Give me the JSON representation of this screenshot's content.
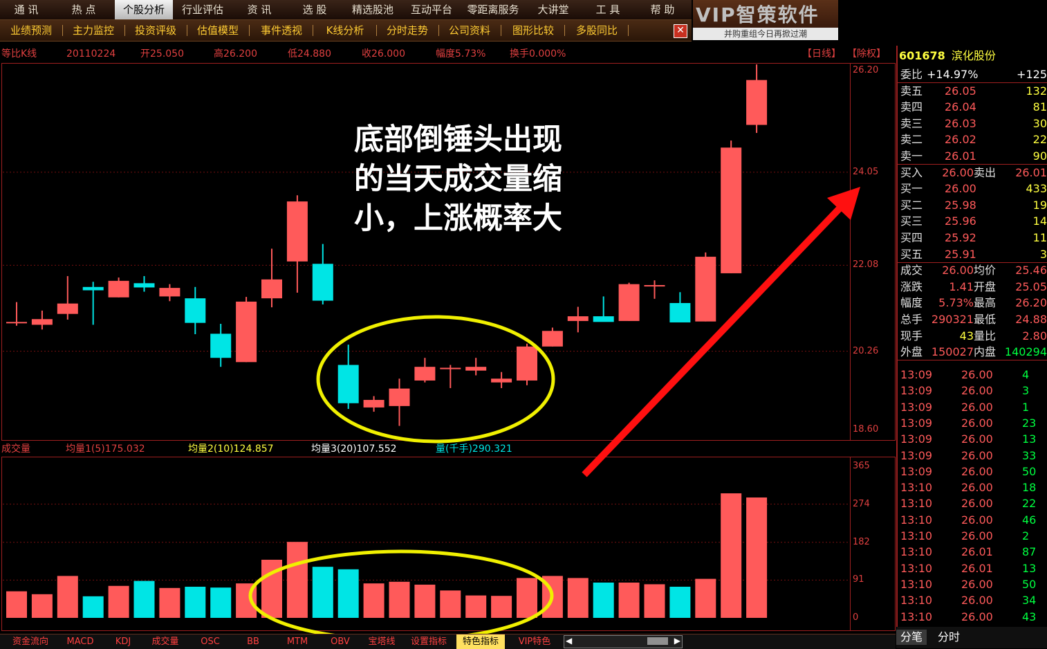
{
  "menu_main": [
    "通 讯",
    "热 点",
    "个股分析",
    "行业评估",
    "资 讯",
    "选 股",
    "精选股池",
    "互动平台",
    "零距离服务",
    "大讲堂",
    "工 具",
    "帮 助"
  ],
  "menu_main_active": 2,
  "menu_sub": [
    "业绩预测",
    "主力监控",
    "投资评级",
    "估值模型",
    "事件透视",
    "K线分析",
    "分时走势",
    "公司资料",
    "图形比较",
    "多股同比"
  ],
  "brand": {
    "title": "VIP智策软件",
    "subtitle": "并购重组今日再掀过潮"
  },
  "info": {
    "chart_name": "等比K线",
    "date": "20110224",
    "open": "开25.050",
    "high": "高26.200",
    "low": "低24.880",
    "close": "收26.000",
    "amp": "幅度5.73%",
    "turnover": "换手0.000%",
    "period_tag": "【日线】",
    "adjust_tag": "【除权】"
  },
  "annotation": "底部倒锤头出现的当天成交量缩小，上涨概率大",
  "volume_bar": {
    "name": "成交量",
    "ma1": "均量1(5)175.032",
    "ma2": "均量2(10)124.857",
    "ma3": "均量3(20)107.552",
    "vol": "量(千手)290.321"
  },
  "colors": {
    "up": "#ff5a5a",
    "down": "#00e5e5",
    "highlight": "#f0f000",
    "arrow": "#ff1010",
    "price_axis": "#e04040"
  },
  "bottom_tabs": [
    "资金流向",
    "MACD",
    "KDJ",
    "成交量",
    "OSC",
    "BB",
    "MTM",
    "OBV",
    "宝塔线",
    "设置指标",
    "特色指标",
    "VIP特色"
  ],
  "bottom_tabs_active": 10,
  "right": {
    "code": "601678",
    "name": "滨化股份",
    "rows": [
      [
        "委比",
        "+14.97%",
        "",
        "+125"
      ],
      [
        "卖五",
        "26.05",
        "",
        "132"
      ],
      [
        "卖四",
        "26.04",
        "",
        "81"
      ],
      [
        "卖三",
        "26.03",
        "",
        "30"
      ],
      [
        "卖二",
        "26.02",
        "",
        "22"
      ],
      [
        "卖一",
        "26.01",
        "",
        "90"
      ],
      [
        "买入",
        "26.00",
        "卖出",
        "26.01"
      ],
      [
        "买一",
        "26.00",
        "",
        "433"
      ],
      [
        "买二",
        "25.98",
        "",
        "19"
      ],
      [
        "买三",
        "25.96",
        "",
        "14"
      ],
      [
        "买四",
        "25.92",
        "",
        "11"
      ],
      [
        "买五",
        "25.91",
        "",
        "3"
      ],
      [
        "成交",
        "26.00",
        "均价",
        "25.46"
      ],
      [
        "涨跌",
        "1.41",
        "开盘",
        "25.05"
      ],
      [
        "幅度",
        "5.73%",
        "最高",
        "26.20"
      ],
      [
        "总手",
        "290321",
        "最低",
        "24.88"
      ],
      [
        "现手",
        "43",
        "量比",
        "2.80"
      ],
      [
        "外盘",
        "150027",
        "内盘",
        "140294"
      ]
    ],
    "ticks": [
      [
        "13:09",
        "26.00",
        "4"
      ],
      [
        "13:09",
        "26.00",
        "3"
      ],
      [
        "13:09",
        "26.00",
        "1"
      ],
      [
        "13:09",
        "26.00",
        "23"
      ],
      [
        "13:09",
        "26.00",
        "13"
      ],
      [
        "13:09",
        "26.00",
        "33"
      ],
      [
        "13:09",
        "26.00",
        "50"
      ],
      [
        "13:10",
        "26.00",
        "18"
      ],
      [
        "13:10",
        "26.00",
        "22"
      ],
      [
        "13:10",
        "26.00",
        "46"
      ],
      [
        "13:10",
        "26.00",
        "2"
      ],
      [
        "13:10",
        "26.01",
        "87"
      ],
      [
        "13:10",
        "26.01",
        "13"
      ],
      [
        "13:10",
        "26.00",
        "50"
      ],
      [
        "13:10",
        "26.00",
        "34"
      ],
      [
        "13:10",
        "26.00",
        "43"
      ]
    ],
    "tabs": [
      "分笔",
      "分时"
    ]
  },
  "chart_data": {
    "type": "candlestick",
    "price_ticks": [
      "26.20",
      "24.05",
      "22.08",
      "20.26",
      "18.60"
    ],
    "volume_ticks": [
      "365",
      "274",
      "182",
      "91",
      "0"
    ],
    "price_range": [
      18.6,
      26.2
    ],
    "volume_range": [
      0,
      365
    ],
    "candles": [
      {
        "o": 20.88,
        "h": 21.3,
        "l": 20.8,
        "c": 20.88
      },
      {
        "o": 20.82,
        "h": 21.12,
        "l": 20.72,
        "c": 20.94
      },
      {
        "o": 21.05,
        "h": 21.85,
        "l": 20.93,
        "c": 21.27
      },
      {
        "o": 21.62,
        "h": 21.73,
        "l": 20.82,
        "c": 21.55
      },
      {
        "o": 21.4,
        "h": 21.82,
        "l": 21.4,
        "c": 21.75
      },
      {
        "o": 21.7,
        "h": 21.85,
        "l": 21.52,
        "c": 21.61
      },
      {
        "o": 21.42,
        "h": 21.68,
        "l": 21.32,
        "c": 21.6
      },
      {
        "o": 21.38,
        "h": 21.62,
        "l": 20.62,
        "c": 20.86
      },
      {
        "o": 20.63,
        "h": 20.84,
        "l": 19.93,
        "c": 20.12
      },
      {
        "o": 20.03,
        "h": 21.41,
        "l": 20.03,
        "c": 21.31
      },
      {
        "o": 21.38,
        "h": 22.43,
        "l": 21.19,
        "c": 21.78
      },
      {
        "o": 22.16,
        "h": 23.56,
        "l": 21.5,
        "c": 23.43
      },
      {
        "o": 22.11,
        "h": 22.53,
        "l": 21.25,
        "c": 21.33
      },
      {
        "o": 19.97,
        "h": 20.4,
        "l": 19.04,
        "c": 19.16
      },
      {
        "o": 19.07,
        "h": 19.31,
        "l": 18.98,
        "c": 19.23
      },
      {
        "o": 19.1,
        "h": 19.68,
        "l": 18.68,
        "c": 19.47
      },
      {
        "o": 19.64,
        "h": 20.12,
        "l": 19.6,
        "c": 19.93
      },
      {
        "o": 19.88,
        "h": 19.97,
        "l": 19.48,
        "c": 19.91
      },
      {
        "o": 19.85,
        "h": 20.12,
        "l": 19.75,
        "c": 19.93
      },
      {
        "o": 19.6,
        "h": 19.82,
        "l": 19.48,
        "c": 19.68
      },
      {
        "o": 19.64,
        "h": 20.42,
        "l": 19.54,
        "c": 20.36
      },
      {
        "o": 20.36,
        "h": 20.76,
        "l": 20.36,
        "c": 20.69
      },
      {
        "o": 20.9,
        "h": 21.2,
        "l": 20.66,
        "c": 21.0
      },
      {
        "o": 21.0,
        "h": 21.42,
        "l": 20.92,
        "c": 20.88
      },
      {
        "o": 20.9,
        "h": 21.71,
        "l": 20.9,
        "c": 21.68
      },
      {
        "o": 21.66,
        "h": 21.76,
        "l": 21.37,
        "c": 21.66
      },
      {
        "o": 21.28,
        "h": 21.51,
        "l": 21.03,
        "c": 20.87
      },
      {
        "o": 20.89,
        "h": 22.35,
        "l": 20.89,
        "c": 22.26
      },
      {
        "o": 21.91,
        "h": 24.72,
        "l": 21.91,
        "c": 24.57
      },
      {
        "o": 25.05,
        "h": 26.33,
        "l": 24.88,
        "c": 26.0
      }
    ],
    "volumes": [
      64,
      57,
      101,
      52,
      77,
      89,
      72,
      75,
      73,
      83,
      140,
      183,
      123,
      117,
      83,
      87,
      80,
      66,
      54,
      53,
      96,
      101,
      96,
      85,
      85,
      81,
      75,
      94,
      300,
      290
    ]
  }
}
